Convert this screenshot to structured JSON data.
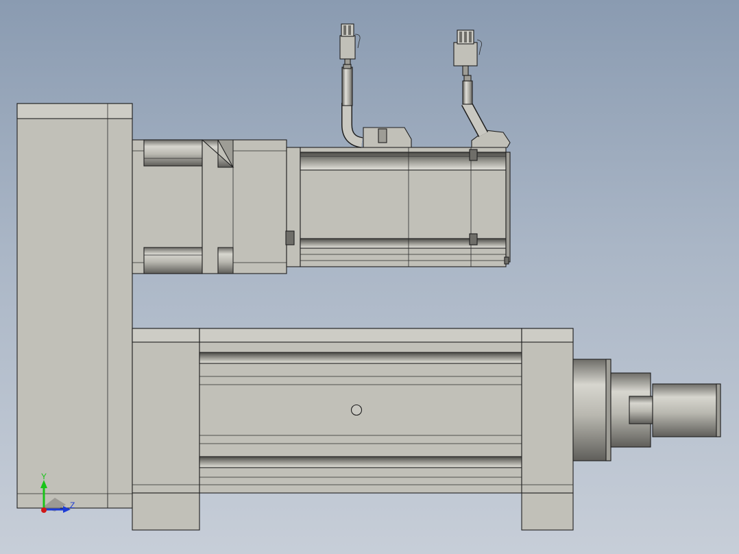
{
  "triad": {
    "y_label": "Y",
    "z_label": "Z",
    "y_color": "#19c419",
    "z_color": "#1c3bd6",
    "x_color": "#d01818"
  },
  "colors": {
    "background_top": "#8a9bb1",
    "background_bottom": "#c7ced8",
    "part_face": "#c1c0b8",
    "edge": "#1e1e1e"
  }
}
